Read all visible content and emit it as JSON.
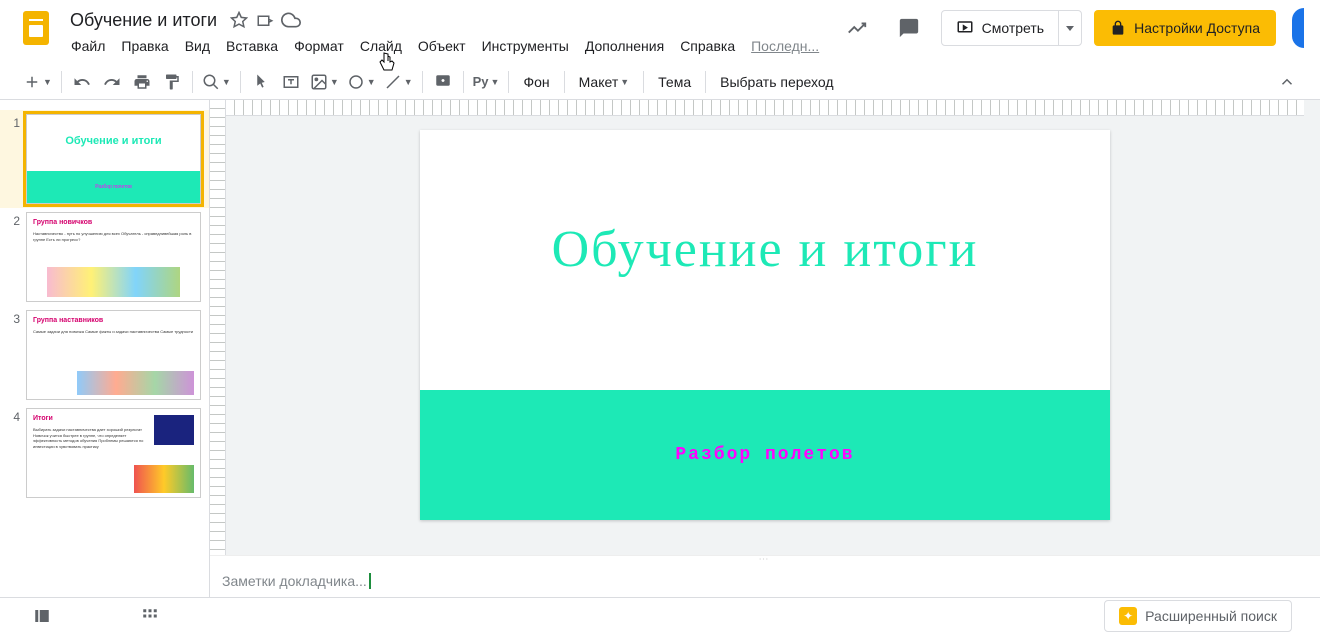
{
  "doc": {
    "title": "Обучение и итоги"
  },
  "menu": {
    "items": [
      "Файл",
      "Правка",
      "Вид",
      "Вставка",
      "Формат",
      "Слайд",
      "Объект",
      "Инструменты",
      "Дополнения",
      "Справка"
    ],
    "last_edit": "Последн..."
  },
  "header_buttons": {
    "present": "Смотреть",
    "share": "Настройки Доступа"
  },
  "toolbar": {
    "py": "Py",
    "background": "Фон",
    "layout": "Макет",
    "theme": "Тема",
    "transition": "Выбрать переход"
  },
  "filmstrip": {
    "slides": [
      {
        "num": "1",
        "title": "Обучение и итоги",
        "subtitle": "Разбор полетов"
      },
      {
        "num": "2",
        "title": "Группа новичков",
        "body": "Наставничество - путь по улучшению для всех\nОбучатель - справедливейшая роль в группе\nЕсть ли прогресс?"
      },
      {
        "num": "3",
        "title": "Группа наставников",
        "body": "Самые задачи для новичка\nСамые факты и задачи наставничества\nСамые трудности"
      },
      {
        "num": "4",
        "title": "Итоги",
        "body": "Выбирать задачи наставничества дает хороший результат\nНовичок учится быстрее в группе, что определяет эффективность методов обучения\nПроблемы решаются по инвестиции в чувствовать практику"
      }
    ]
  },
  "canvas": {
    "title": "Обучение и итоги",
    "subtitle": "Разбор  полетов"
  },
  "notes": {
    "placeholder": "Заметки докладчика..."
  },
  "footer": {
    "explore": "Расширенный поиск"
  }
}
